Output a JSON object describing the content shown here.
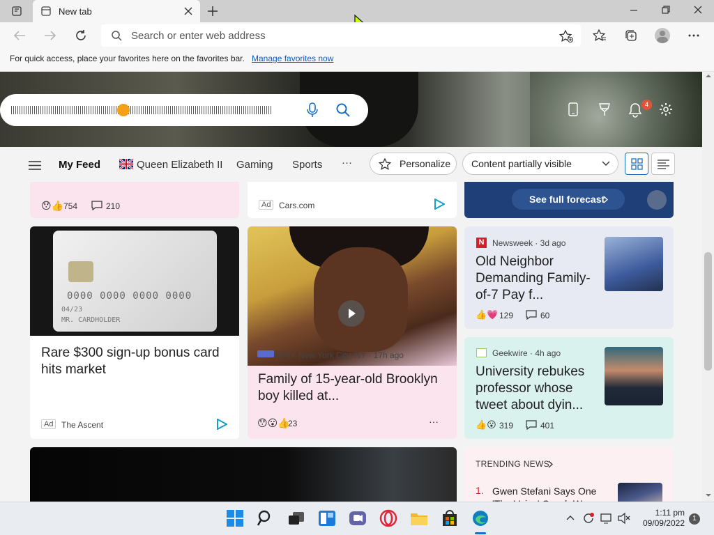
{
  "browser": {
    "tab_title": "New tab",
    "address_placeholder": "Search or enter web address",
    "favbar_text": "For quick access, place your favorites here on the favorites bar.",
    "favbar_link": "Manage favorites now"
  },
  "hero": {
    "notification_count": "4"
  },
  "feednav": {
    "my_feed": "My Feed",
    "queen": "Queen Elizabeth II",
    "gaming": "Gaming",
    "sports": "Sports",
    "more": "···",
    "personalize": "Personalize",
    "content_select": "Content partially visible"
  },
  "cards": {
    "top_left": {
      "likes": "754",
      "comments": "210"
    },
    "top_mid": {
      "ad": "Ad",
      "source": "Cars.com"
    },
    "weather": {
      "forecast": "See full forecast"
    },
    "card1": {
      "card_number": "0000 0000 0000 0000",
      "card_date": "04/23",
      "card_holder": "MR. CARDHOLDER",
      "title": "Rare $300 sign-up bonus card hits market",
      "ad": "Ad",
      "source": "The Ascent"
    },
    "card2": {
      "source": "WPIX New York City, NY · 17h ago",
      "title": "Family of 15-year-old Brooklyn boy killed at...",
      "reactions": "23",
      "menu": "···"
    },
    "card3": {
      "source": "Newsweek · 3d ago",
      "title": "Old Neighbor Demanding Family-of-7 Pay f...",
      "likes": "129",
      "comments": "60"
    },
    "card4": {
      "source": "Geekwire · 4h ago",
      "title": "University rebukes professor whose tweet about dyin...",
      "likes": "319",
      "comments": "401"
    },
    "trending": {
      "header": "TRENDING NEWS",
      "item1_num": "1.",
      "item1_text": "Gwen Stefani Says One 'The Voice' Coach W..."
    }
  },
  "taskbar": {
    "time": "1:11 pm",
    "date": "09/09/2022",
    "badge": "1"
  },
  "colors": {
    "accent": "#0a5dc2",
    "weather_bg": "#1e3f78",
    "pink_card": "#fbe4ee",
    "teal_card": "#d9f2ee"
  }
}
